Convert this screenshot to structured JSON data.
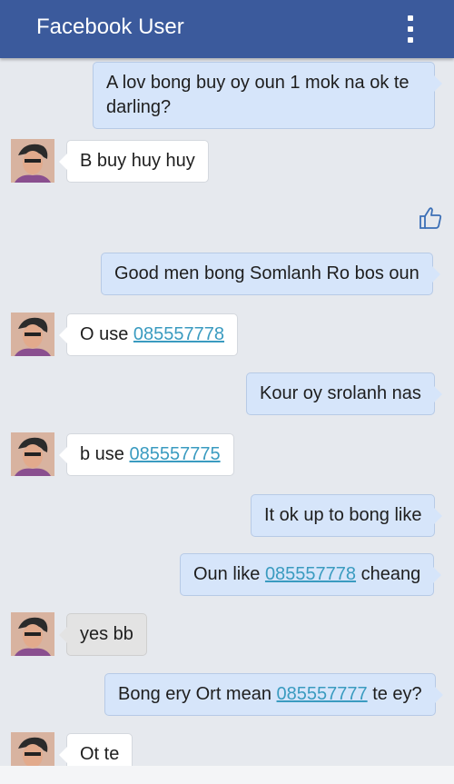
{
  "header": {
    "title": "Facebook User",
    "menu_icon": "overflow-menu-icon"
  },
  "messages": [
    {
      "direction": "out",
      "text": "A lov bong buy oy oun 1 mok na ok te darling?"
    },
    {
      "direction": "in",
      "text": "B buy huy huy"
    },
    {
      "direction": "out",
      "type": "like",
      "icon": "thumbs-up-icon"
    },
    {
      "direction": "out",
      "text": "Good men bong Somlanh Ro bos oun"
    },
    {
      "direction": "in",
      "prefix": "O use ",
      "link": "085557778"
    },
    {
      "direction": "out",
      "text": "Kour oy srolanh nas"
    },
    {
      "direction": "in",
      "prefix": "b use ",
      "link": "085557775"
    },
    {
      "direction": "out",
      "text": "It ok up to bong like"
    },
    {
      "direction": "out",
      "prefix": "Oun like ",
      "link": "085557778",
      "suffix": " cheang"
    },
    {
      "direction": "in",
      "text": "yes bb",
      "style": "selected"
    },
    {
      "direction": "out",
      "prefix": "Bong ery Ort mean ",
      "link": "085557777",
      "suffix": " te ey?"
    },
    {
      "direction": "in",
      "text": "Ot te"
    }
  ],
  "colors": {
    "header": "#3b5a9c",
    "out_bubble": "#d6e5fa",
    "in_bubble": "#ffffff",
    "link": "#3a9bc0",
    "background": "#e6e9ee"
  }
}
